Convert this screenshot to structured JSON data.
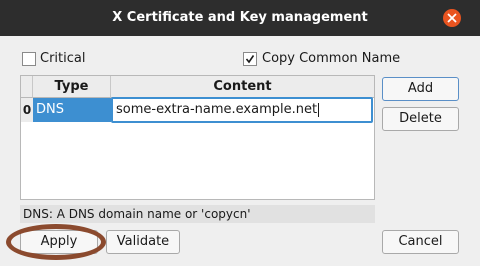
{
  "window": {
    "title": "X Certificate and Key management",
    "accent": "#e95420"
  },
  "options": {
    "critical": {
      "label": "Critical",
      "checked": false
    },
    "copy_common_name": {
      "label": "Copy Common Name",
      "checked": true
    }
  },
  "table": {
    "headers": [
      "Type",
      "Content"
    ],
    "rows": [
      {
        "index": "0",
        "type": "DNS",
        "content": "some-extra-name.example.net"
      }
    ]
  },
  "buttons": {
    "add": "Add",
    "delete": "Delete",
    "apply": "Apply",
    "validate": "Validate",
    "cancel": "Cancel"
  },
  "info_text": "DNS: A DNS domain name or 'copycn'",
  "annotation": {
    "color": "#8b4a2e",
    "target": "apply-button"
  }
}
